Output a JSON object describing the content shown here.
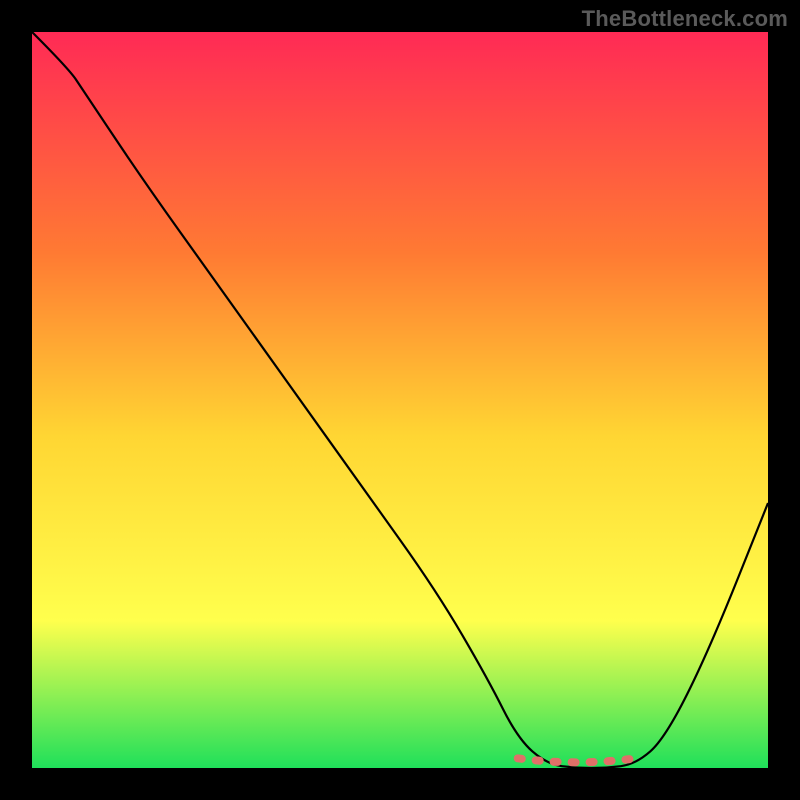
{
  "watermark": "TheBottleneck.com",
  "colors": {
    "frame": "#000000",
    "gradient_top": "#ff2a55",
    "gradient_mid1": "#ff7a33",
    "gradient_mid2": "#ffd633",
    "gradient_mid3": "#ffff4d",
    "gradient_bottom": "#1fe05a",
    "line": "#000000",
    "valley_marker": "#e07068"
  },
  "chart_data": {
    "type": "line",
    "title": "",
    "xlabel": "",
    "ylabel": "",
    "xlim": [
      0,
      100
    ],
    "ylim": [
      0,
      100
    ],
    "series": [
      {
        "name": "bottleneck-curve",
        "x": [
          0,
          5,
          7,
          15,
          25,
          35,
          45,
          55,
          62,
          66,
          70,
          74,
          78,
          82,
          86,
          92,
          100
        ],
        "y": [
          100,
          95,
          92,
          80,
          66,
          52,
          38,
          24,
          12,
          4,
          0.5,
          0,
          0,
          0.5,
          4,
          16,
          36
        ]
      }
    ],
    "annotations": [
      {
        "name": "valley-marker",
        "x_range": [
          66,
          82
        ],
        "y": 0.5,
        "style": "thick-dashed"
      }
    ]
  }
}
